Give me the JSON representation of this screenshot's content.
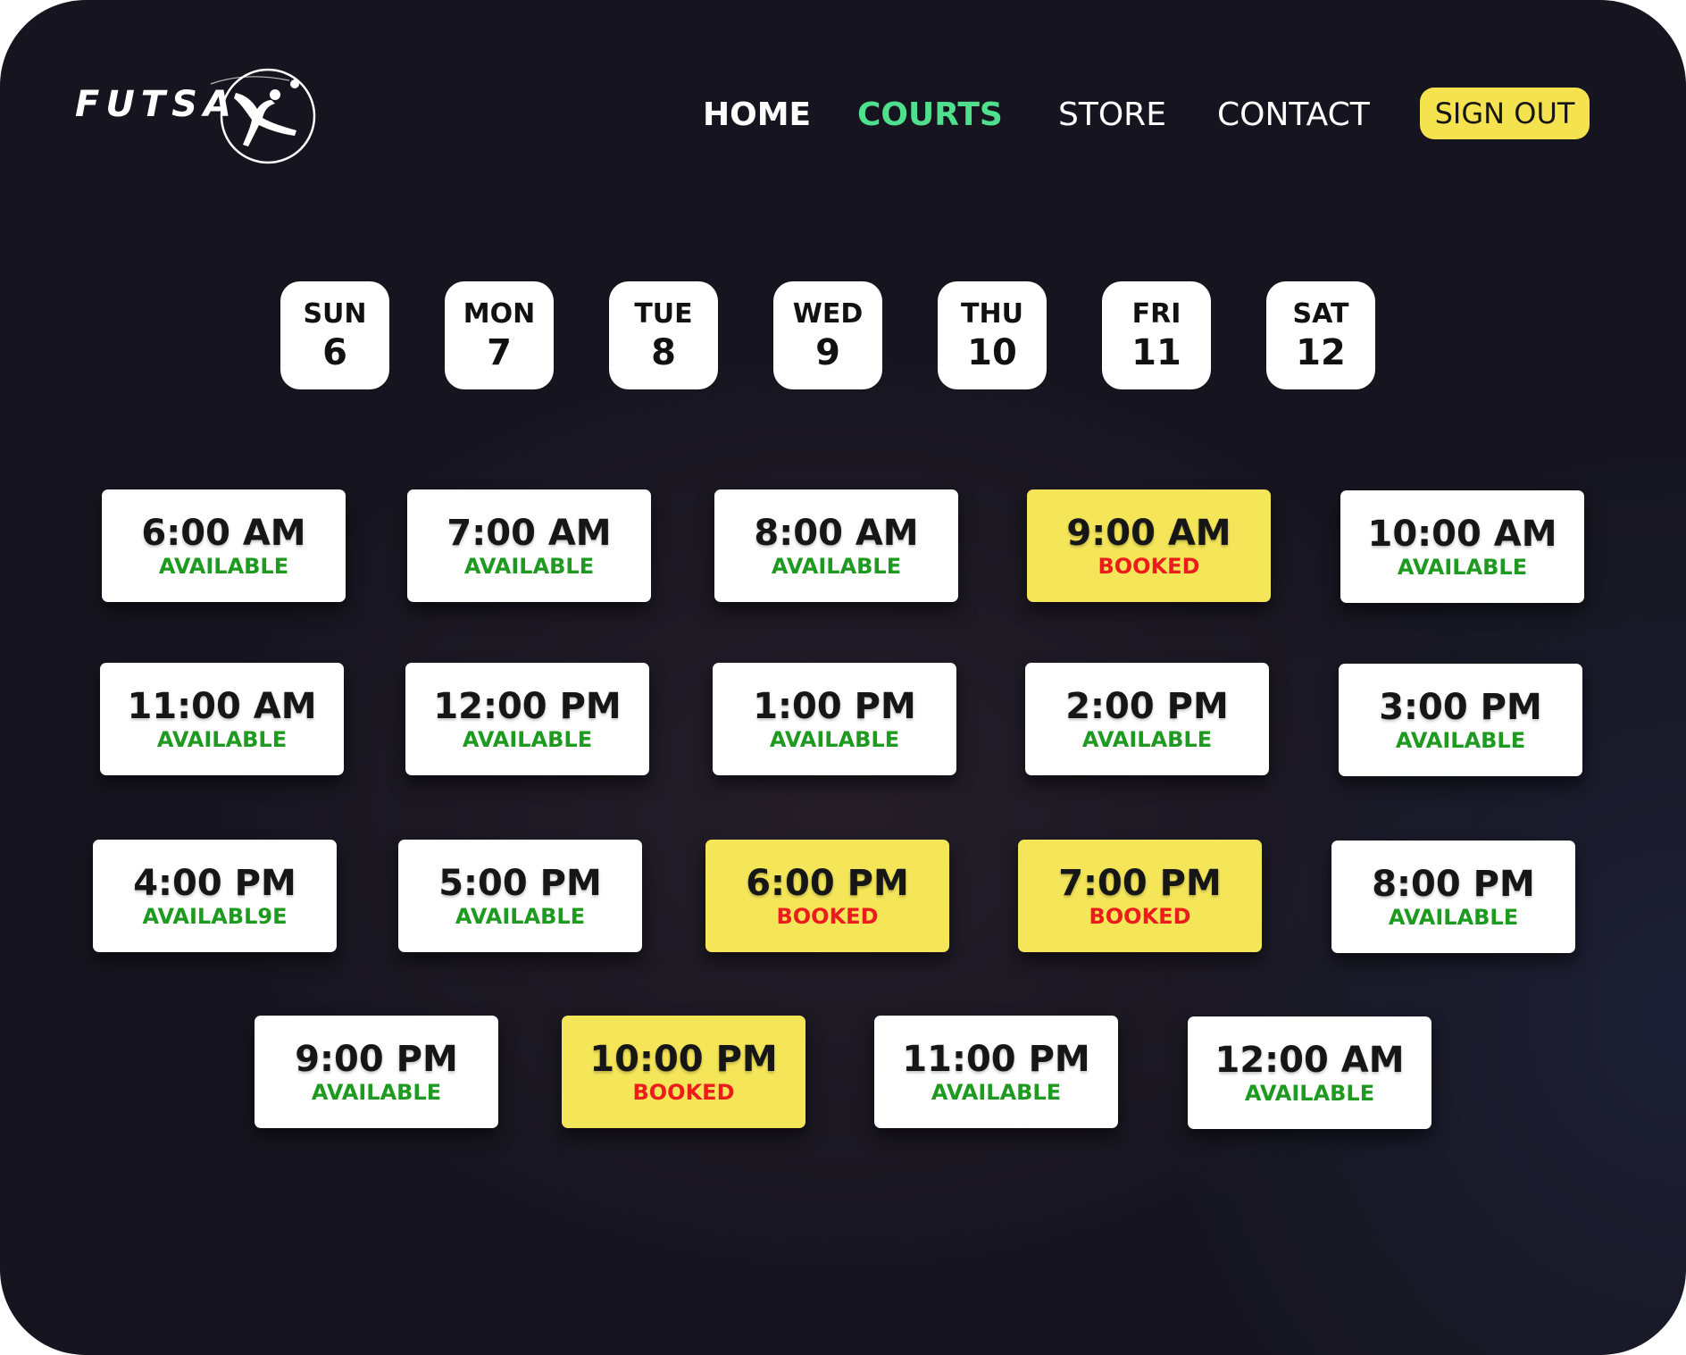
{
  "brand": {
    "name": "FUTSA",
    "logo_icon": "bicycle-kick-player-icon"
  },
  "nav": {
    "items": [
      {
        "label": "HOME",
        "active": false
      },
      {
        "label": "COURTS",
        "active": true
      },
      {
        "label": "STORE",
        "active": false
      },
      {
        "label": "CONTACT",
        "active": false
      }
    ],
    "sign_out_label": "SIGN OUT"
  },
  "colors": {
    "background": "#16151f",
    "active_nav": "#4ee08d",
    "accent_yellow": "#f5e24f",
    "available_green": "#1f9a20",
    "booked_red": "#ec1c1c"
  },
  "days": [
    {
      "name": "SUN",
      "num": "6"
    },
    {
      "name": "MON",
      "num": "7"
    },
    {
      "name": "TUE",
      "num": "8"
    },
    {
      "name": "WED",
      "num": "9"
    },
    {
      "name": "THU",
      "num": "10"
    },
    {
      "name": "FRI",
      "num": "11"
    },
    {
      "name": "SAT",
      "num": "12"
    }
  ],
  "slots": [
    {
      "time": "6:00 AM",
      "status": "AVAILABLE",
      "booked": false
    },
    {
      "time": "7:00 AM",
      "status": "AVAILABLE",
      "booked": false
    },
    {
      "time": "8:00 AM",
      "status": "AVAILABLE",
      "booked": false
    },
    {
      "time": "9:00 AM",
      "status": "BOOKED",
      "booked": true
    },
    {
      "time": "10:00 AM",
      "status": "AVAILABLE",
      "booked": false
    },
    {
      "time": "11:00 AM",
      "status": "AVAILABLE",
      "booked": false
    },
    {
      "time": "12:00 PM",
      "status": "AVAILABLE",
      "booked": false
    },
    {
      "time": "1:00 PM",
      "status": "AVAILABLE",
      "booked": false
    },
    {
      "time": "2:00 PM",
      "status": "AVAILABLE",
      "booked": false
    },
    {
      "time": "3:00 PM",
      "status": "AVAILABLE",
      "booked": false
    },
    {
      "time": "4:00 PM",
      "status": "AVAILABL9E",
      "booked": false
    },
    {
      "time": "5:00 PM",
      "status": "AVAILABLE",
      "booked": false
    },
    {
      "time": "6:00 PM",
      "status": "BOOKED",
      "booked": true
    },
    {
      "time": "7:00 PM",
      "status": "BOOKED",
      "booked": true
    },
    {
      "time": "8:00 PM",
      "status": "AVAILABLE",
      "booked": false
    },
    {
      "time": "9:00 PM",
      "status": "AVAILABLE",
      "booked": false
    },
    {
      "time": "10:00 PM",
      "status": "BOOKED",
      "booked": true
    },
    {
      "time": "11:00 PM",
      "status": "AVAILABLE",
      "booked": false
    },
    {
      "time": "12:00 AM",
      "status": "AVAILABLE",
      "booked": false
    }
  ]
}
